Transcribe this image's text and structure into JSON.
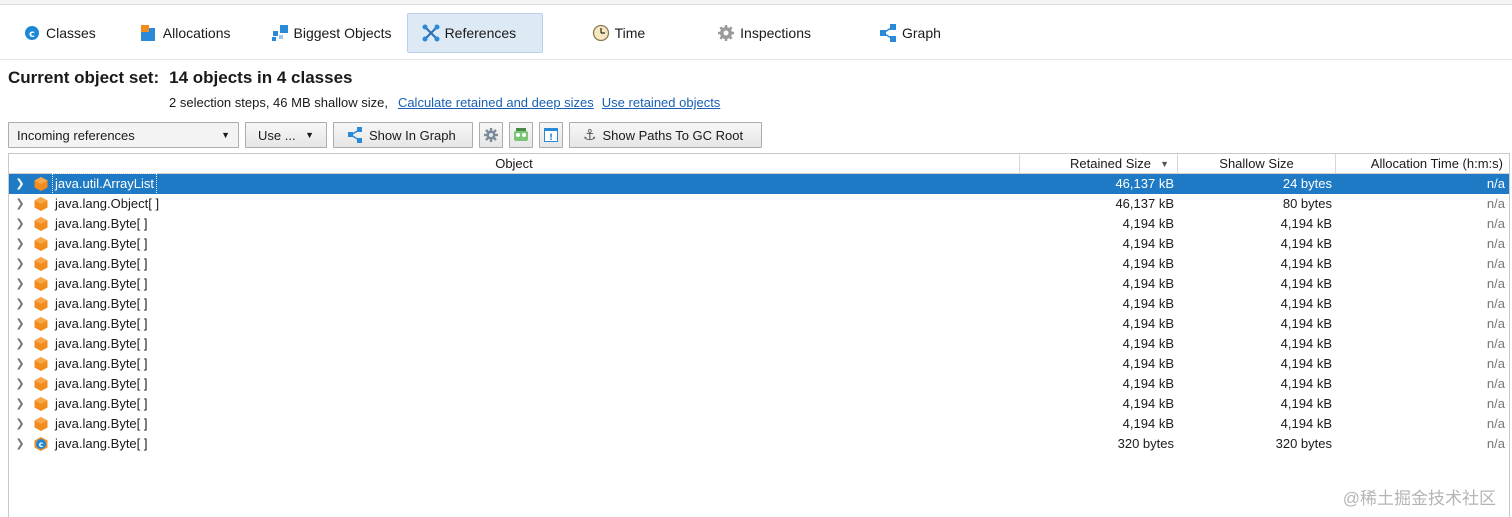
{
  "tabs": [
    {
      "label": "Classes",
      "icon": "class-icon"
    },
    {
      "label": "Allocations",
      "icon": "allocations-icon"
    },
    {
      "label": "Biggest Objects",
      "icon": "biggest-objects-icon"
    },
    {
      "label": "References",
      "icon": "references-icon",
      "active": true
    },
    {
      "label": "Time",
      "icon": "clock-icon"
    },
    {
      "label": "Inspections",
      "icon": "gear-icon"
    },
    {
      "label": "Graph",
      "icon": "graph-icon"
    }
  ],
  "header": {
    "title_prefix": "Current object set:",
    "title_count": "14 objects in 4 classes",
    "subtitle": "2 selection steps, 46 MB shallow size,",
    "link_calc": "Calculate retained and deep sizes",
    "link_use_retained": "Use retained objects"
  },
  "toolbar": {
    "view_select": "Incoming references",
    "use_button": "Use ...",
    "show_in_graph": "Show In Graph",
    "show_paths": "Show Paths To GC Root"
  },
  "table": {
    "columns": [
      "Object",
      "Retained Size",
      "Shallow Size",
      "Allocation Time (h:m:s)"
    ],
    "rows": [
      {
        "name": "java.util.ArrayList",
        "retained": "46,137 kB",
        "shallow": "24 bytes",
        "alloc": "n/a",
        "icon": "instance-icon",
        "selected": true
      },
      {
        "name": "java.lang.Object[ ]",
        "retained": "46,137 kB",
        "shallow": "80 bytes",
        "alloc": "n/a",
        "icon": "instance-icon"
      },
      {
        "name": "java.lang.Byte[ ]",
        "retained": "4,194 kB",
        "shallow": "4,194 kB",
        "alloc": "n/a",
        "icon": "instance-icon"
      },
      {
        "name": "java.lang.Byte[ ]",
        "retained": "4,194 kB",
        "shallow": "4,194 kB",
        "alloc": "n/a",
        "icon": "instance-icon"
      },
      {
        "name": "java.lang.Byte[ ]",
        "retained": "4,194 kB",
        "shallow": "4,194 kB",
        "alloc": "n/a",
        "icon": "instance-icon"
      },
      {
        "name": "java.lang.Byte[ ]",
        "retained": "4,194 kB",
        "shallow": "4,194 kB",
        "alloc": "n/a",
        "icon": "instance-icon"
      },
      {
        "name": "java.lang.Byte[ ]",
        "retained": "4,194 kB",
        "shallow": "4,194 kB",
        "alloc": "n/a",
        "icon": "instance-icon"
      },
      {
        "name": "java.lang.Byte[ ]",
        "retained": "4,194 kB",
        "shallow": "4,194 kB",
        "alloc": "n/a",
        "icon": "instance-icon"
      },
      {
        "name": "java.lang.Byte[ ]",
        "retained": "4,194 kB",
        "shallow": "4,194 kB",
        "alloc": "n/a",
        "icon": "instance-icon"
      },
      {
        "name": "java.lang.Byte[ ]",
        "retained": "4,194 kB",
        "shallow": "4,194 kB",
        "alloc": "n/a",
        "icon": "instance-icon"
      },
      {
        "name": "java.lang.Byte[ ]",
        "retained": "4,194 kB",
        "shallow": "4,194 kB",
        "alloc": "n/a",
        "icon": "instance-icon"
      },
      {
        "name": "java.lang.Byte[ ]",
        "retained": "4,194 kB",
        "shallow": "4,194 kB",
        "alloc": "n/a",
        "icon": "instance-icon"
      },
      {
        "name": "java.lang.Byte[ ]",
        "retained": "4,194 kB",
        "shallow": "4,194 kB",
        "alloc": "n/a",
        "icon": "instance-icon"
      },
      {
        "name": "java.lang.Byte[ ]",
        "retained": "320 bytes",
        "shallow": "320 bytes",
        "alloc": "n/a",
        "icon": "class-object-icon"
      }
    ]
  },
  "watermark": "@稀土掘金技术社区",
  "colors": {
    "selection": "#1e7ac4",
    "link": "#1a5fb4",
    "instance": "#f28c1c",
    "active_tab": "#dde9f5"
  }
}
